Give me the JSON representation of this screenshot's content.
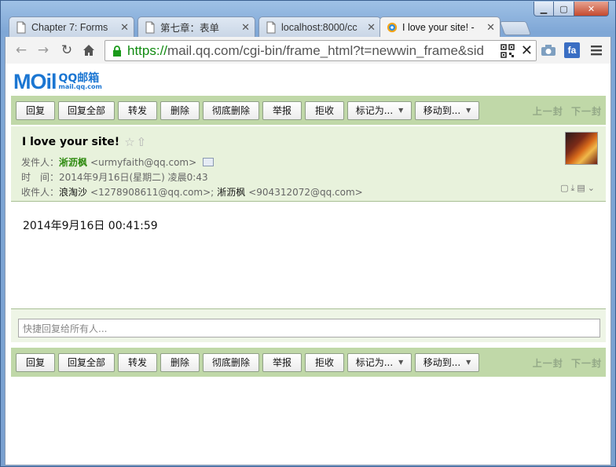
{
  "window": {
    "controls": {
      "minimize": "▁",
      "maximize": "▢",
      "close": "✕"
    }
  },
  "tabs": [
    {
      "title": "Chapter 7: Forms",
      "icon": "page-icon",
      "active": false
    },
    {
      "title": "第七章：表单",
      "icon": "page-icon",
      "active": false
    },
    {
      "title": "localhost:8000/cc",
      "icon": "page-icon",
      "active": false
    },
    {
      "title": "I love your site! -",
      "icon": "qqmail-icon",
      "active": true
    }
  ],
  "toolbar": {
    "url_scheme": "https://",
    "url_rest": "mail.qq.com/cgi-bin/frame_html?t=newwin_frame&sid"
  },
  "mail": {
    "logo": {
      "main": "MOil",
      "sub1": "QQ邮箱",
      "sub2": "mail.qq.com"
    },
    "actions": {
      "reply": "回复",
      "reply_all": "回复全部",
      "forward": "转发",
      "delete": "删除",
      "delete_permanently": "彻底删除",
      "report": "举报",
      "reject": "拒收",
      "mark_as": "标记为...",
      "move_to": "移动到..."
    },
    "nav": {
      "prev": "上一封",
      "next": "下一封"
    },
    "subject": "I love your site!",
    "sender_label": "发件人：",
    "sender_name": "淅沥枫",
    "sender_email": "<urmyfaith@qq.com>",
    "time_label": "时　间：",
    "time_value": "2014年9月16日(星期二) 凌晨0:43",
    "recipients_label": "收件人：",
    "recipient1_name": "浪淘沙",
    "recipient1_email": "<1278908611@qq.com>;",
    "recipient2_name": "淅沥枫",
    "recipient2_email": "<904312072@qq.com>",
    "body": "2014年9月16日 00:41:59",
    "quick_reply_placeholder": "快捷回复给所有人..."
  }
}
